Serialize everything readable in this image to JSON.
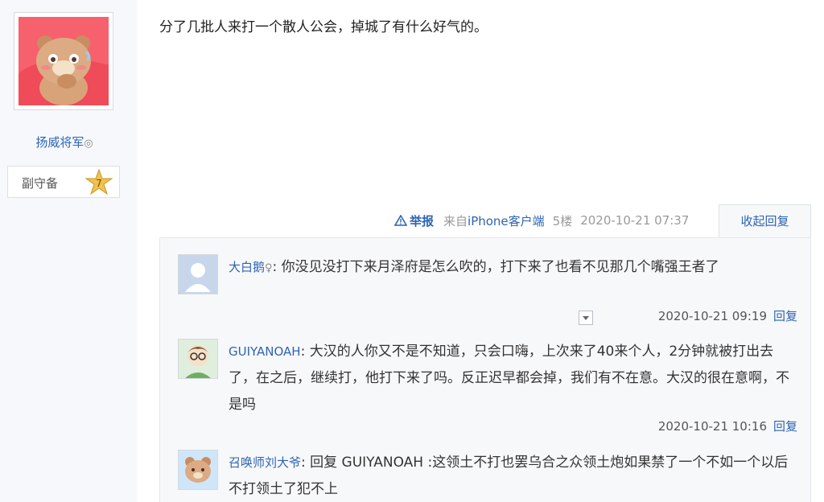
{
  "author": {
    "username": "扬威将军",
    "verify_mark": "◎",
    "rank_title": "副守备",
    "level": "7"
  },
  "post": {
    "content": "分了几批人来打一个散人公会，掉城了有什么好气的。",
    "report_label": "举报",
    "source_prefix": "来自",
    "source_device": "iPhone客户端",
    "floor": "5楼",
    "timestamp": "2020-10-21 07:37",
    "collapse_label": "收起回复"
  },
  "replies": [
    {
      "name": "大白鹅",
      "gender_mark": "♀",
      "text": ": 你没见没打下来月泽府是怎么吹的，打下来了也看不见那几个嘴强王者了",
      "time": "2020-10-21 09:19",
      "reply_label": "回复"
    },
    {
      "name": "GUIYANOAH",
      "gender_mark": "",
      "text": ": 大汉的人你又不是不知道，只会口嗨，上次来了40来个人，2分钟就被打出去了，在之后，继续打，他打下来了吗。反正迟早都会掉，我们有不在意。大汉的很在意啊，不是吗",
      "time": "2020-10-21 10:16",
      "reply_label": "回复"
    },
    {
      "name": "召唤师刘大爷",
      "gender_mark": "",
      "text": ": 回复 GUIYANOAH :这领土不打也罢乌合之众领土炮如果禁了一个不如一个以后不打领土了犯不上",
      "time": "",
      "reply_label": ""
    }
  ],
  "icons": {
    "report": "warning-triangle-icon",
    "expand": "chevron-down-icon"
  },
  "colors": {
    "link": "#2d64b3",
    "avatar_bg": "#f4525f"
  }
}
